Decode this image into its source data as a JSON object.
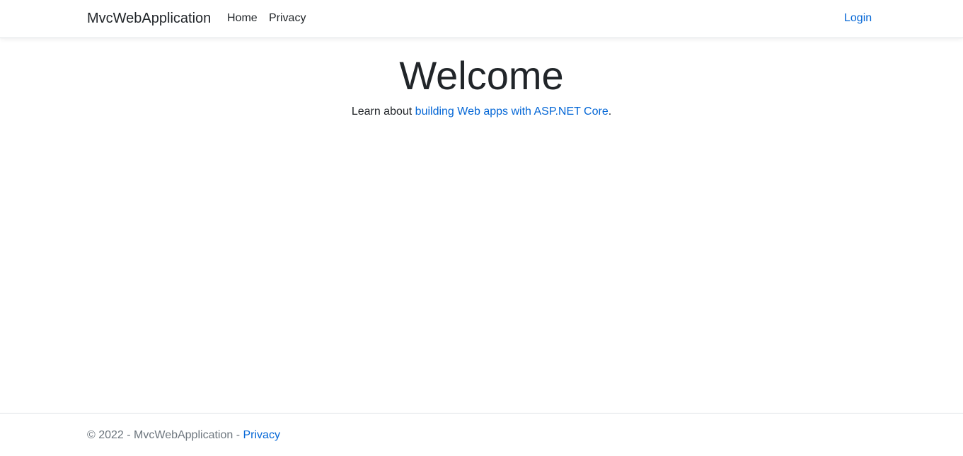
{
  "navbar": {
    "brand": "MvcWebApplication",
    "links": [
      {
        "label": "Home"
      },
      {
        "label": "Privacy"
      }
    ],
    "login_label": "Login"
  },
  "main": {
    "heading": "Welcome",
    "lead_prefix": "Learn about ",
    "lead_link": "building Web apps with ASP.NET Core",
    "lead_suffix": "."
  },
  "footer": {
    "copyright": "© 2022 - MvcWebApplication - ",
    "privacy_link": "Privacy"
  },
  "colors": {
    "link": "#0366d6",
    "text": "#212529",
    "muted": "#6c757d",
    "border": "#dee2e6"
  }
}
